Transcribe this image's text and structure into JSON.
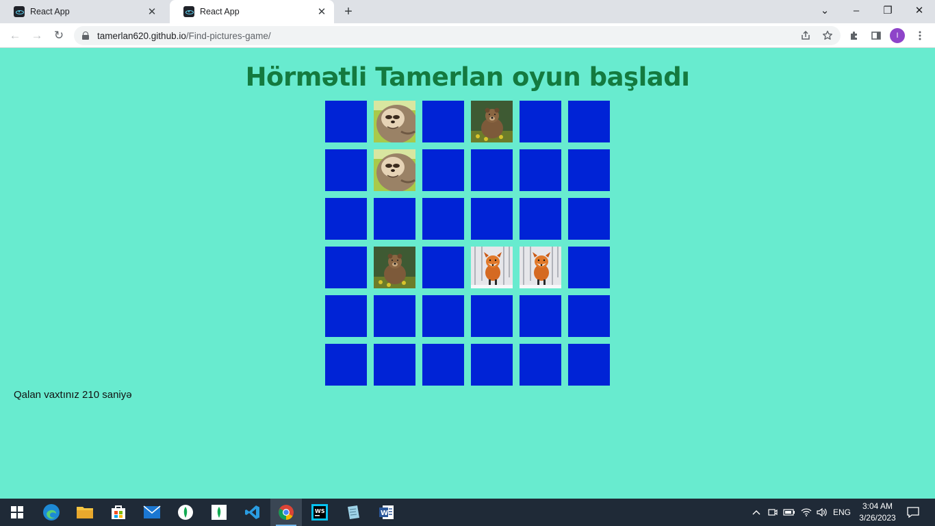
{
  "browser": {
    "tabs": [
      {
        "title": "React App",
        "close": "✕",
        "favicon": "react-icon"
      },
      {
        "title": "React App",
        "close": "✕",
        "favicon": "react-icon"
      }
    ],
    "new_tab": "+",
    "window_controls": {
      "tab_search": "⌄",
      "minimize": "–",
      "restore": "❐",
      "close": "✕"
    },
    "nav": {
      "back": "←",
      "forward": "→",
      "reload": "↻"
    },
    "url_host": "tamerlan620.github.io",
    "url_path": "/Find-pictures-game/",
    "profile_initial": "I",
    "icons": [
      "share-icon",
      "star-icon",
      "extensions-icon",
      "side-panel-icon",
      "menu-icon"
    ]
  },
  "game": {
    "title": "Hörmətli Tamerlan oyun başladı",
    "timer_text": "Qalan vaxtınız 210 saniyə",
    "card_back_color": "#0023d6",
    "board": [
      [
        "hidden",
        "sloth",
        "hidden",
        "bear",
        "hidden",
        "hidden"
      ],
      [
        "hidden",
        "sloth",
        "hidden",
        "hidden",
        "hidden",
        "hidden"
      ],
      [
        "hidden",
        "hidden",
        "hidden",
        "hidden",
        "hidden",
        "hidden"
      ],
      [
        "hidden",
        "bear",
        "hidden",
        "fox",
        "fox",
        "hidden"
      ],
      [
        "hidden",
        "hidden",
        "hidden",
        "hidden",
        "hidden",
        "hidden"
      ],
      [
        "hidden",
        "hidden",
        "hidden",
        "hidden",
        "hidden",
        "hidden"
      ]
    ]
  },
  "taskbar": {
    "apps": [
      "windows-start-icon",
      "edge-icon",
      "file-explorer-icon",
      "store-icon",
      "mail-icon",
      "mongodb-compass-icon",
      "mongodb-icon",
      "vscode-icon",
      "chrome-icon",
      "webstorm-icon",
      "notepad-icon",
      "word-icon"
    ],
    "language": "ENG",
    "time": "3:04 AM",
    "date": "3/26/2023"
  }
}
